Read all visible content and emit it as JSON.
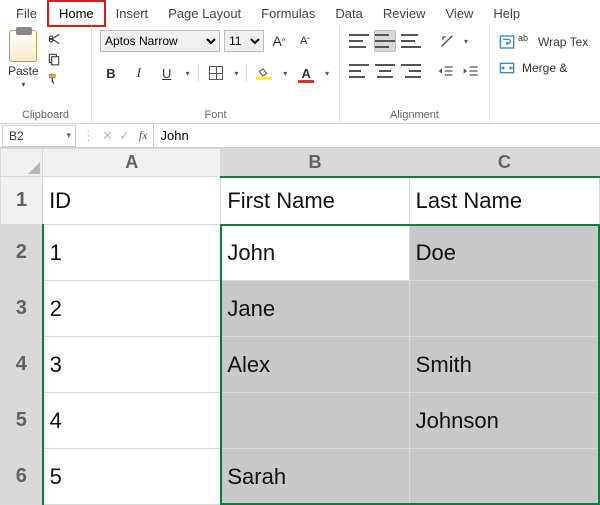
{
  "menu": {
    "tabs": [
      "File",
      "Home",
      "Insert",
      "Page Layout",
      "Formulas",
      "Data",
      "Review",
      "View",
      "Help"
    ],
    "active": "Home"
  },
  "ribbon": {
    "clipboard": {
      "paste_label": "Paste",
      "group_label": "Clipboard"
    },
    "font": {
      "font_name": "Aptos Narrow",
      "font_size": "11",
      "increase": "Aˆ",
      "decrease": "Aˇ",
      "bold": "B",
      "italic": "I",
      "underline": "U",
      "group_label": "Font"
    },
    "alignment": {
      "group_label": "Alignment",
      "wrap_label": "Wrap Tex",
      "merge_label": "Merge &",
      "wrap_prefix": "ab"
    }
  },
  "formula_bar": {
    "name_box": "B2",
    "fx": "fx",
    "value": "John"
  },
  "sheet": {
    "columns": [
      "A",
      "B",
      "C"
    ],
    "rows": [
      {
        "n": "1",
        "A": "ID",
        "B": "First Name",
        "C": "Last Name"
      },
      {
        "n": "2",
        "A": "1",
        "B": "John",
        "C": "Doe"
      },
      {
        "n": "3",
        "A": "2",
        "B": "Jane",
        "C": ""
      },
      {
        "n": "4",
        "A": "3",
        "B": "Alex",
        "C": "Smith"
      },
      {
        "n": "5",
        "A": "4",
        "B": "",
        "C": "Johnson"
      },
      {
        "n": "6",
        "A": "5",
        "B": "Sarah",
        "C": ""
      }
    ],
    "selection": {
      "active": "B2",
      "range_cols": [
        "B",
        "C"
      ],
      "range_rows": [
        "2",
        "3",
        "4",
        "5",
        "6"
      ]
    }
  }
}
